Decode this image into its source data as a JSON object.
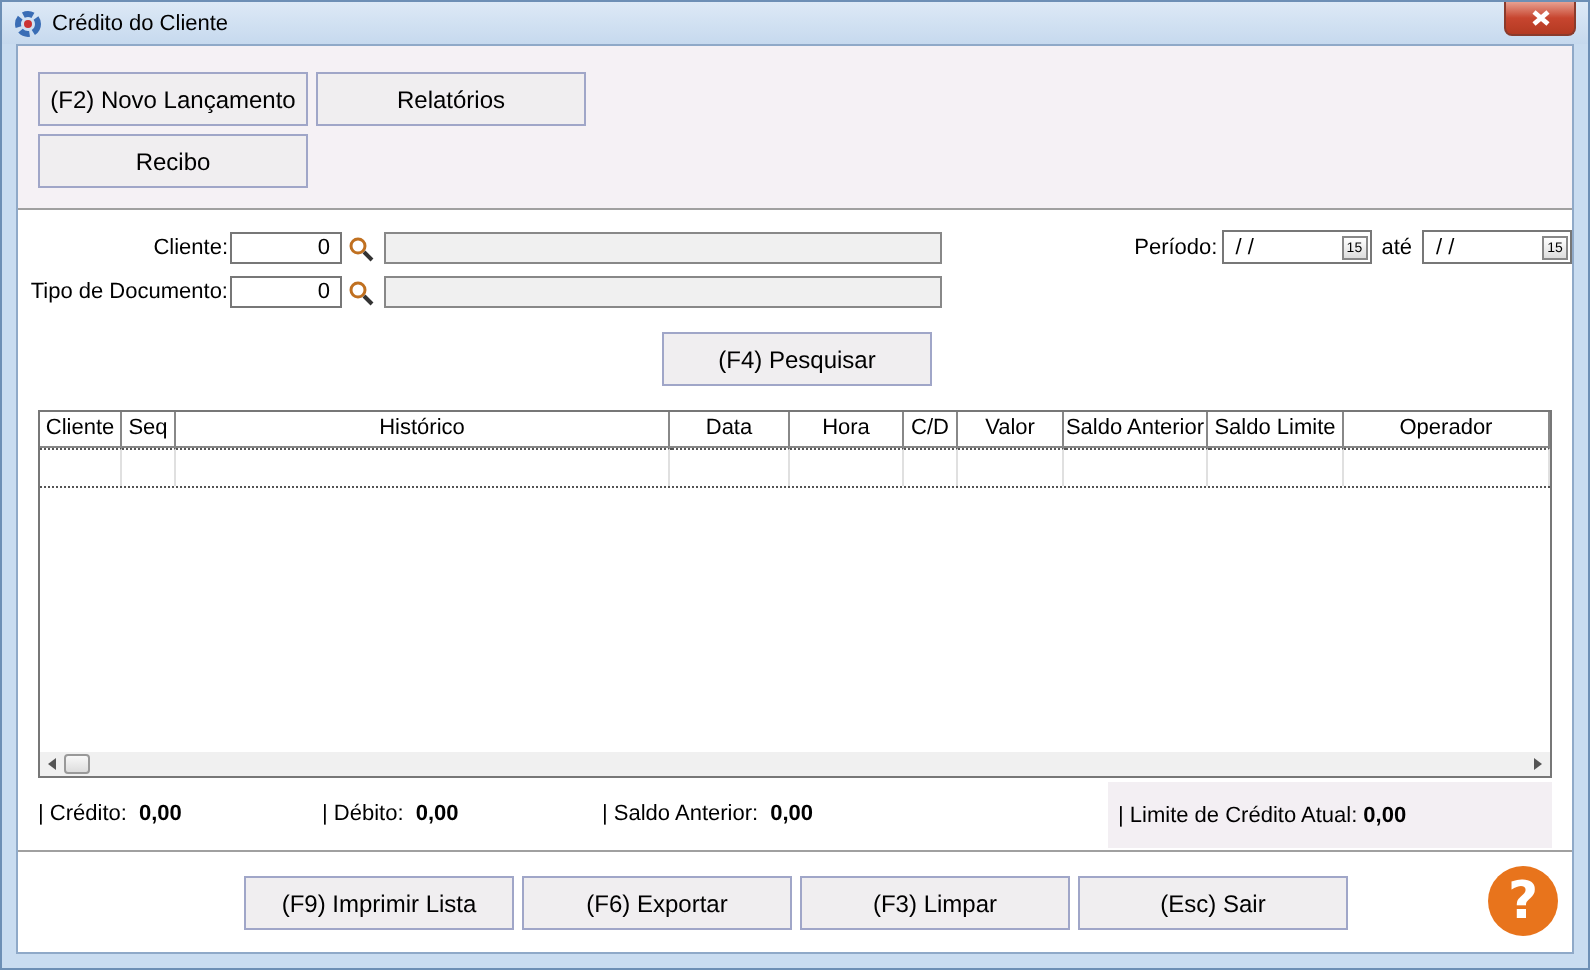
{
  "window": {
    "title": "Crédito do Cliente"
  },
  "top_buttons": [
    {
      "label": "(F2) Novo Lançamento"
    },
    {
      "label": "Relatórios"
    },
    {
      "label": "Recibo"
    }
  ],
  "filters": [
    {
      "label": "Cliente:",
      "value": "0"
    },
    {
      "label": "Tipo de Documento:",
      "value": "0"
    }
  ],
  "period": {
    "label": "Período:",
    "from": "/ /",
    "from_calendar": "15",
    "to_label": "até",
    "to": "/ /",
    "to_calendar": "15"
  },
  "search_button": "(F4) Pesquisar",
  "table": {
    "columns": [
      "Cliente",
      "Seq",
      "Histórico",
      "Data",
      "Hora",
      "C/D",
      "Valor",
      "Saldo Anterior",
      "Saldo Limite",
      "Operador"
    ]
  },
  "totals": [
    {
      "label": "| Crédito:",
      "value": "0,00"
    },
    {
      "label": "| Débito:",
      "value": "0,00"
    },
    {
      "label": "| Saldo Anterior:",
      "value": "0,00"
    }
  ],
  "credit_limit": {
    "label": "| Limite de Crédito Atual:",
    "value": "0,00"
  },
  "bottom_buttons": [
    {
      "label": "(F9) Imprimir Lista"
    },
    {
      "label": "(F6) Exportar"
    },
    {
      "label": "(F3) Limpar"
    },
    {
      "label": "(Esc) Sair"
    }
  ],
  "help_button": "?"
}
